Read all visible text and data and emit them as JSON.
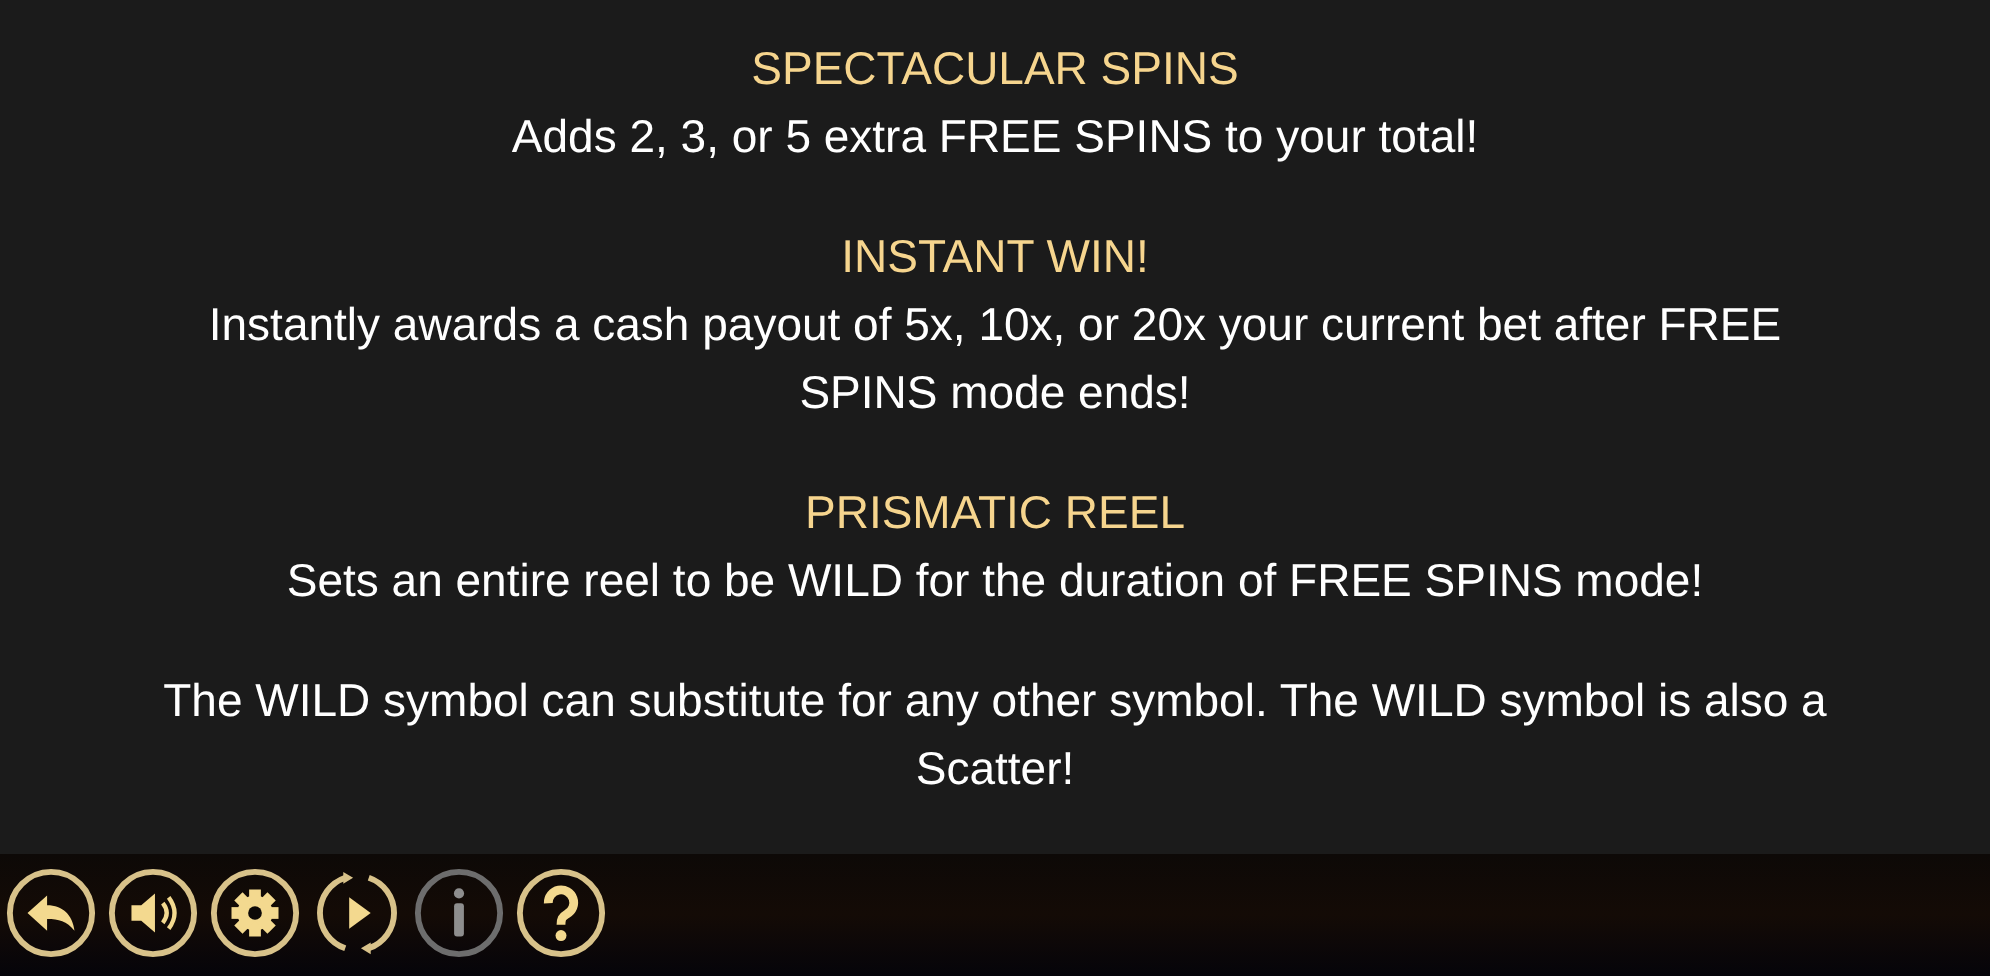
{
  "sections": [
    {
      "title": "SPECTACULAR SPINS",
      "body": "Adds 2, 3, or 5 extra FREE SPINS to your total!"
    },
    {
      "title": "INSTANT WIN!",
      "body": "Instantly awards a cash payout of 5x, 10x, or 20x your current bet after FREE SPINS mode ends!"
    },
    {
      "title": "PRISMATIC REEL",
      "body": "Sets an entire reel to be WILD for the duration of FREE SPINS mode!"
    },
    {
      "body": "The WILD symbol can substitute for any other symbol. The WILD symbol is also a Scatter!"
    }
  ],
  "toolbar": [
    {
      "kind": "back",
      "selected": false
    },
    {
      "kind": "sound",
      "selected": false
    },
    {
      "kind": "settings",
      "selected": false
    },
    {
      "kind": "autoplay",
      "selected": false
    },
    {
      "kind": "info",
      "selected": true
    },
    {
      "kind": "help",
      "selected": false
    }
  ]
}
